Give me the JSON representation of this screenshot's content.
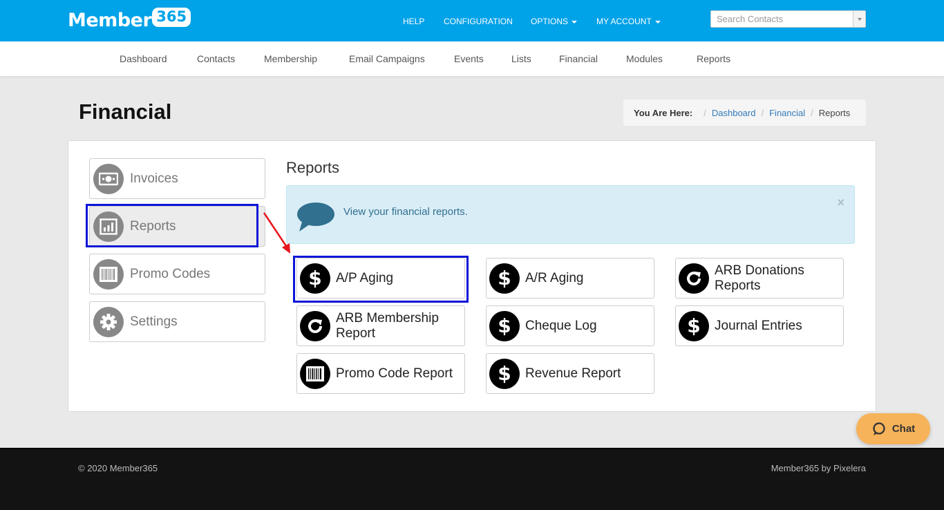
{
  "logo": {
    "text": "Member",
    "badge": "365"
  },
  "topnav": {
    "help": "HELP",
    "configuration": "CONFIGURATION",
    "options": "OPTIONS",
    "my_account": "MY ACCOUNT"
  },
  "search": {
    "placeholder": "Search Contacts"
  },
  "mainnav": {
    "dashboard": "Dashboard",
    "contacts": "Contacts",
    "membership": "Membership",
    "email_campaigns": "Email Campaigns",
    "events": "Events",
    "lists": "Lists",
    "financial": "Financial",
    "modules": "Modules",
    "reports": "Reports"
  },
  "page": {
    "title": "Financial"
  },
  "breadcrumb": {
    "label": "You Are Here:",
    "items": [
      "Dashboard",
      "Financial"
    ],
    "current": "Reports"
  },
  "sidebar": {
    "items": [
      {
        "label": "Invoices",
        "icon": "money-bill-icon"
      },
      {
        "label": "Reports",
        "icon": "bar-chart-icon",
        "active": true
      },
      {
        "label": "Promo Codes",
        "icon": "barcode-icon"
      },
      {
        "label": "Settings",
        "icon": "gear-icon"
      }
    ]
  },
  "reports": {
    "heading": "Reports",
    "alert": "View your financial reports.",
    "close": "×",
    "tiles": [
      {
        "label": "A/P Aging",
        "icon": "dollar-icon"
      },
      {
        "label": "A/R Aging",
        "icon": "dollar-icon"
      },
      {
        "label": "ARB Donations Reports",
        "icon": "refresh-icon"
      },
      {
        "label": "ARB Membership Report",
        "icon": "refresh-icon"
      },
      {
        "label": "Cheque Log",
        "icon": "dollar-icon"
      },
      {
        "label": "Journal Entries",
        "icon": "dollar-icon"
      },
      {
        "label": "Promo Code Report",
        "icon": "barcode-icon"
      },
      {
        "label": "Revenue Report",
        "icon": "dollar-icon"
      }
    ]
  },
  "chat": {
    "label": "Chat"
  },
  "footer": {
    "copyright": "© 2020 Member365",
    "credit": "Member365 by Pixelera"
  },
  "colors": {
    "topbar": "#00a2e8",
    "highlight": "#0a14d6",
    "arrow": "#e8141c",
    "chat": "#f6b35a",
    "alert_bg": "#d9edf7",
    "link": "#337ab7"
  }
}
